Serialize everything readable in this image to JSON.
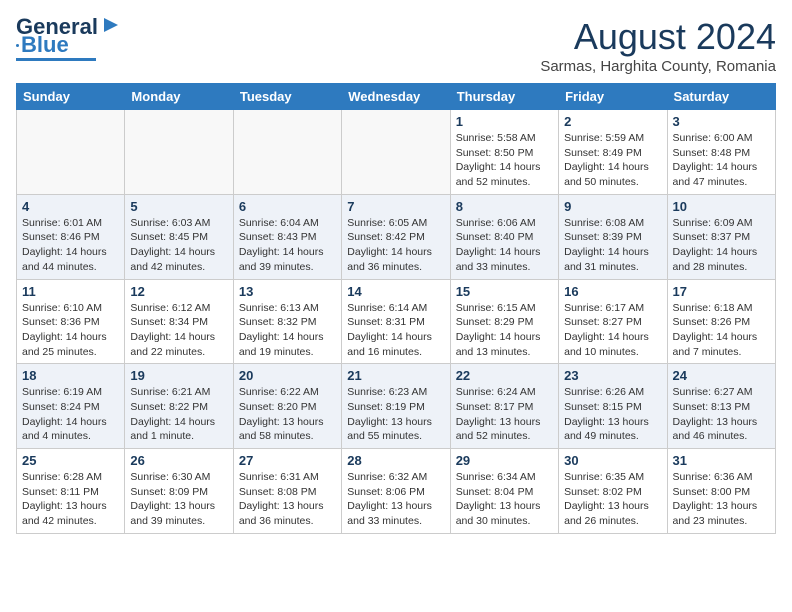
{
  "header": {
    "logo_line1": "General",
    "logo_line2": "Blue",
    "month_year": "August 2024",
    "subtitle": "Sarmas, Harghita County, Romania"
  },
  "days_of_week": [
    "Sunday",
    "Monday",
    "Tuesday",
    "Wednesday",
    "Thursday",
    "Friday",
    "Saturday"
  ],
  "weeks": [
    [
      {
        "day": "",
        "info": ""
      },
      {
        "day": "",
        "info": ""
      },
      {
        "day": "",
        "info": ""
      },
      {
        "day": "",
        "info": ""
      },
      {
        "day": "1",
        "info": "Sunrise: 5:58 AM\nSunset: 8:50 PM\nDaylight: 14 hours\nand 52 minutes."
      },
      {
        "day": "2",
        "info": "Sunrise: 5:59 AM\nSunset: 8:49 PM\nDaylight: 14 hours\nand 50 minutes."
      },
      {
        "day": "3",
        "info": "Sunrise: 6:00 AM\nSunset: 8:48 PM\nDaylight: 14 hours\nand 47 minutes."
      }
    ],
    [
      {
        "day": "4",
        "info": "Sunrise: 6:01 AM\nSunset: 8:46 PM\nDaylight: 14 hours\nand 44 minutes."
      },
      {
        "day": "5",
        "info": "Sunrise: 6:03 AM\nSunset: 8:45 PM\nDaylight: 14 hours\nand 42 minutes."
      },
      {
        "day": "6",
        "info": "Sunrise: 6:04 AM\nSunset: 8:43 PM\nDaylight: 14 hours\nand 39 minutes."
      },
      {
        "day": "7",
        "info": "Sunrise: 6:05 AM\nSunset: 8:42 PM\nDaylight: 14 hours\nand 36 minutes."
      },
      {
        "day": "8",
        "info": "Sunrise: 6:06 AM\nSunset: 8:40 PM\nDaylight: 14 hours\nand 33 minutes."
      },
      {
        "day": "9",
        "info": "Sunrise: 6:08 AM\nSunset: 8:39 PM\nDaylight: 14 hours\nand 31 minutes."
      },
      {
        "day": "10",
        "info": "Sunrise: 6:09 AM\nSunset: 8:37 PM\nDaylight: 14 hours\nand 28 minutes."
      }
    ],
    [
      {
        "day": "11",
        "info": "Sunrise: 6:10 AM\nSunset: 8:36 PM\nDaylight: 14 hours\nand 25 minutes."
      },
      {
        "day": "12",
        "info": "Sunrise: 6:12 AM\nSunset: 8:34 PM\nDaylight: 14 hours\nand 22 minutes."
      },
      {
        "day": "13",
        "info": "Sunrise: 6:13 AM\nSunset: 8:32 PM\nDaylight: 14 hours\nand 19 minutes."
      },
      {
        "day": "14",
        "info": "Sunrise: 6:14 AM\nSunset: 8:31 PM\nDaylight: 14 hours\nand 16 minutes."
      },
      {
        "day": "15",
        "info": "Sunrise: 6:15 AM\nSunset: 8:29 PM\nDaylight: 14 hours\nand 13 minutes."
      },
      {
        "day": "16",
        "info": "Sunrise: 6:17 AM\nSunset: 8:27 PM\nDaylight: 14 hours\nand 10 minutes."
      },
      {
        "day": "17",
        "info": "Sunrise: 6:18 AM\nSunset: 8:26 PM\nDaylight: 14 hours\nand 7 minutes."
      }
    ],
    [
      {
        "day": "18",
        "info": "Sunrise: 6:19 AM\nSunset: 8:24 PM\nDaylight: 14 hours\nand 4 minutes."
      },
      {
        "day": "19",
        "info": "Sunrise: 6:21 AM\nSunset: 8:22 PM\nDaylight: 14 hours\nand 1 minute."
      },
      {
        "day": "20",
        "info": "Sunrise: 6:22 AM\nSunset: 8:20 PM\nDaylight: 13 hours\nand 58 minutes."
      },
      {
        "day": "21",
        "info": "Sunrise: 6:23 AM\nSunset: 8:19 PM\nDaylight: 13 hours\nand 55 minutes."
      },
      {
        "day": "22",
        "info": "Sunrise: 6:24 AM\nSunset: 8:17 PM\nDaylight: 13 hours\nand 52 minutes."
      },
      {
        "day": "23",
        "info": "Sunrise: 6:26 AM\nSunset: 8:15 PM\nDaylight: 13 hours\nand 49 minutes."
      },
      {
        "day": "24",
        "info": "Sunrise: 6:27 AM\nSunset: 8:13 PM\nDaylight: 13 hours\nand 46 minutes."
      }
    ],
    [
      {
        "day": "25",
        "info": "Sunrise: 6:28 AM\nSunset: 8:11 PM\nDaylight: 13 hours\nand 42 minutes."
      },
      {
        "day": "26",
        "info": "Sunrise: 6:30 AM\nSunset: 8:09 PM\nDaylight: 13 hours\nand 39 minutes."
      },
      {
        "day": "27",
        "info": "Sunrise: 6:31 AM\nSunset: 8:08 PM\nDaylight: 13 hours\nand 36 minutes."
      },
      {
        "day": "28",
        "info": "Sunrise: 6:32 AM\nSunset: 8:06 PM\nDaylight: 13 hours\nand 33 minutes."
      },
      {
        "day": "29",
        "info": "Sunrise: 6:34 AM\nSunset: 8:04 PM\nDaylight: 13 hours\nand 30 minutes."
      },
      {
        "day": "30",
        "info": "Sunrise: 6:35 AM\nSunset: 8:02 PM\nDaylight: 13 hours\nand 26 minutes."
      },
      {
        "day": "31",
        "info": "Sunrise: 6:36 AM\nSunset: 8:00 PM\nDaylight: 13 hours\nand 23 minutes."
      }
    ]
  ]
}
